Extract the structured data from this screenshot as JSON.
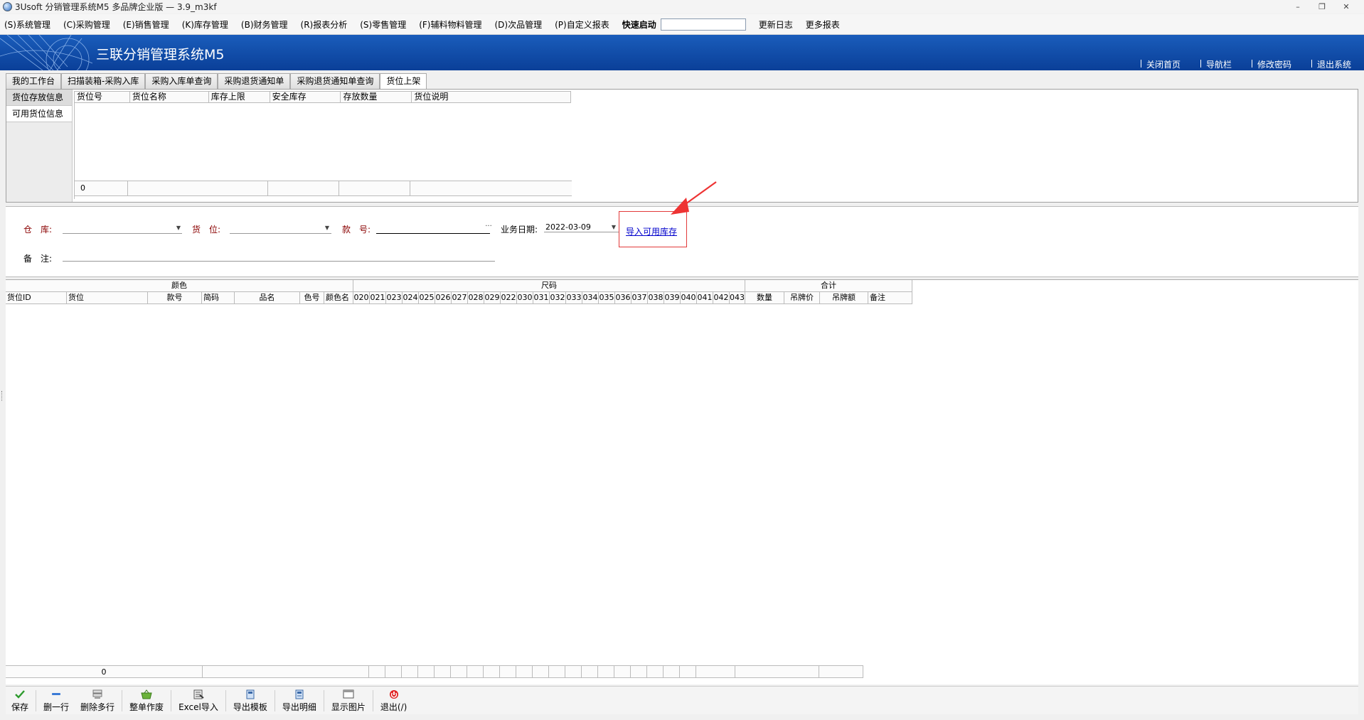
{
  "window": {
    "title": "3Usoft 分销管理系统M5 多品牌企业版 — 3.9_m3kf",
    "min_glyph": "–",
    "restore_glyph": "❐",
    "close_glyph": "✕"
  },
  "menu": {
    "items": [
      {
        "label": "(S)系统管理"
      },
      {
        "label": "(C)采购管理"
      },
      {
        "label": "(E)销售管理"
      },
      {
        "label": "(K)库存管理"
      },
      {
        "label": "(B)财务管理"
      },
      {
        "label": "(R)报表分析"
      },
      {
        "label": "(S)零售管理"
      },
      {
        "label": "(F)辅料物料管理"
      },
      {
        "label": "(D)次品管理"
      },
      {
        "label": "(P)自定义报表"
      }
    ],
    "quick_start": "快速启动",
    "update_log": "更新日志",
    "more_reports": "更多报表"
  },
  "banner": {
    "title": "三联分销管理系统M5",
    "links": [
      {
        "label": "关闭首页"
      },
      {
        "label": "导航栏"
      },
      {
        "label": "修改密码"
      },
      {
        "label": "退出系统"
      }
    ]
  },
  "tabs": [
    {
      "label": "我的工作台"
    },
    {
      "label": "扫描装箱-采购入库"
    },
    {
      "label": "采购入库单查询"
    },
    {
      "label": "采购退货通知单"
    },
    {
      "label": "采购退货通知单查询"
    },
    {
      "label": "货位上架"
    }
  ],
  "side_tabs": [
    {
      "label": "货位存放信息"
    },
    {
      "label": "可用货位信息"
    }
  ],
  "location_grid": {
    "columns": [
      "货位号",
      "货位名称",
      "库存上限",
      "安全库存",
      "存放数量",
      "货位说明"
    ],
    "footer_count": "0"
  },
  "form": {
    "warehouse_label": "仓　库:",
    "location_label": "货　位:",
    "style_label": "款　号:",
    "style_btn": "···",
    "date_label": "业务日期:",
    "date_value": "2022-03-09",
    "remark_label": "备　注:",
    "import_link": "导入可用库存"
  },
  "detail_grid": {
    "group_headers": [
      "颜色",
      "尺码",
      "合计"
    ],
    "left_columns": [
      "货位ID",
      "货位",
      "款号",
      "简码",
      "品名",
      "色号",
      "颜色名"
    ],
    "size_columns": [
      "020",
      "021",
      "023",
      "024",
      "025",
      "026",
      "027",
      "028",
      "029",
      "022",
      "030",
      "031",
      "032",
      "033",
      "034",
      "035",
      "036",
      "037",
      "038",
      "039",
      "040",
      "041",
      "042",
      "043"
    ],
    "total_columns": [
      "数量",
      "吊牌价",
      "吊牌额",
      "备注"
    ],
    "footer_count": "0"
  },
  "toolbar": [
    {
      "label": "保存",
      "icon": "check-icon"
    },
    {
      "label": "删一行",
      "icon": "minus-icon"
    },
    {
      "label": "删除多行",
      "icon": "delete-rows-icon"
    },
    {
      "label": "整单作废",
      "icon": "basket-icon"
    },
    {
      "label": "Excel导入",
      "icon": "excel-icon"
    },
    {
      "label": "导出模板",
      "icon": "export-template-icon"
    },
    {
      "label": "导出明细",
      "icon": "export-detail-icon"
    },
    {
      "label": "显示图片",
      "icon": "picture-icon"
    },
    {
      "label": "退出(/)",
      "icon": "exit-icon"
    }
  ]
}
